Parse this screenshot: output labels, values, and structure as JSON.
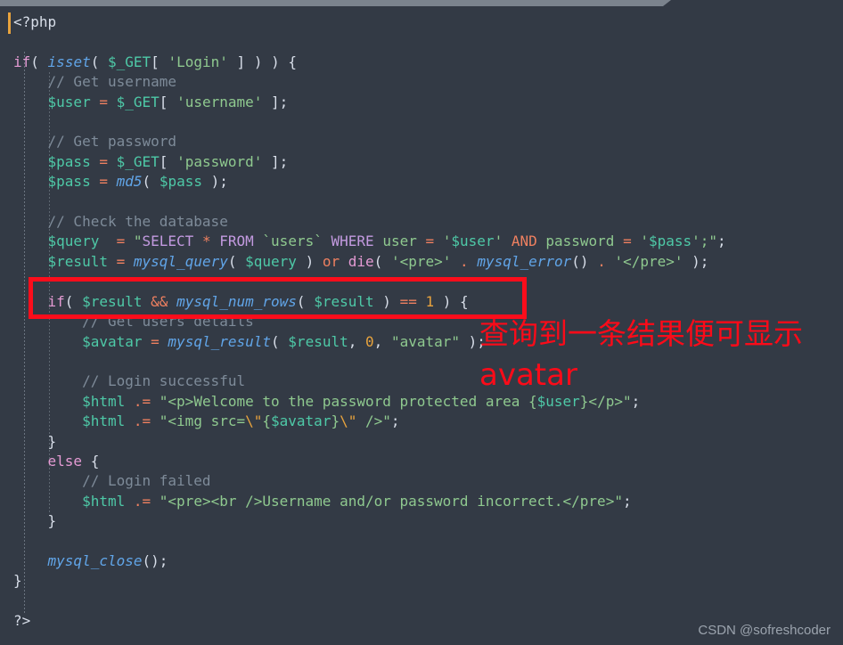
{
  "window": {
    "background_color": "#333a45",
    "chrome_bar_color": "#7b838d"
  },
  "editor": {
    "language": "php",
    "caret_color": "#e8a33d",
    "lines": [
      "<?php",
      "",
      "if( isset( $_GET[ 'Login' ] ) ) {",
      "    // Get username",
      "    $user = $_GET[ 'username' ];",
      "",
      "    // Get password",
      "    $pass = $_GET[ 'password' ];",
      "    $pass = md5( $pass );",
      "",
      "    // Check the database",
      "    $query  = \"SELECT * FROM `users` WHERE user = '$user' AND password = '$pass';\";",
      "    $result = mysql_query( $query ) or die( '<pre>' . mysql_error() . '</pre>' );",
      "",
      "    if( $result && mysql_num_rows( $result ) == 1 ) {",
      "        // Get users details",
      "        $avatar = mysql_result( $result, 0, \"avatar\" );",
      "",
      "        // Login successful",
      "        $html .= \"<p>Welcome to the password protected area {$user}</p>\";",
      "        $html .= \"<img src=\\\"{$avatar}\\\" />\";",
      "    }",
      "    else {",
      "        // Login failed",
      "        $html .= \"<pre><br />Username and/or password incorrect.</pre>\";",
      "    }",
      "",
      "    mysql_close();",
      "}",
      "",
      "?>"
    ]
  },
  "annotations": {
    "highlight_box": {
      "color": "#fc0d1b",
      "targets_line": "if( $result && mysql_num_rows( $result ) == 1 ) {"
    },
    "note_chinese": "查询到一条结果便可显示",
    "note_english": "avatar",
    "note_color": "#fb0b19"
  },
  "watermark": {
    "text": "CSDN @sofreshcoder"
  }
}
